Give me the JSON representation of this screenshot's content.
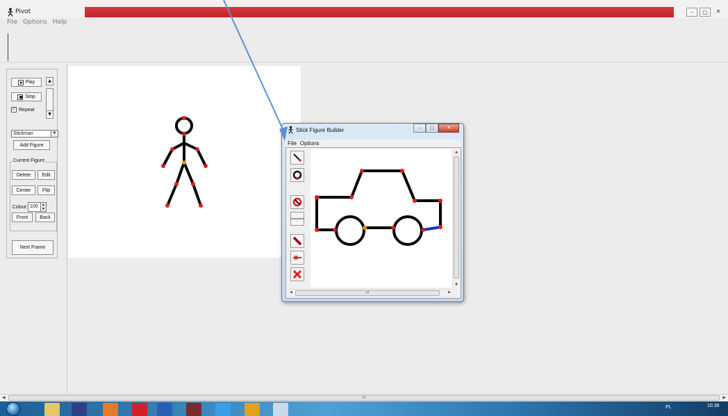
{
  "app": {
    "title": "Pivot",
    "menu": [
      "File",
      "Options",
      "Help"
    ],
    "window_controls": [
      "–",
      "▢",
      "✕"
    ]
  },
  "controls": {
    "play_label": "Play",
    "stop_label": "Stop",
    "repeat_label": "Repeat",
    "repeat_checked": "✓",
    "figure_select": "Stickman",
    "add_figure_label": "Add Figure",
    "current_figure_legend": "Current Figure",
    "delete_label": "Delete",
    "edit_label": "Edit",
    "center_label": "Center",
    "flip_label": "Flip",
    "colour_label": "Colour",
    "colour_value": "100",
    "front_label": "Front",
    "back_label": "Back",
    "next_frame_label": "Next Frame"
  },
  "builder": {
    "title": "Stick Figure Builder",
    "menu": [
      "File",
      "Options"
    ],
    "controls": [
      "–",
      "▢",
      "✕"
    ],
    "scroll_grip": "III"
  },
  "main_scroll_grip": "III",
  "taskbar": {
    "lang": "PL",
    "time": "10:38"
  },
  "colors": {
    "title_accent": "#d0303a",
    "joint_red": "#e01b1b",
    "joint_orange": "#f08a00",
    "segment_blue": "#1030e0",
    "arrow": "#5b8fd4",
    "tool_red": "#e01b1b"
  },
  "icons": {
    "tool_line": "line-tool-icon",
    "tool_circle": "circle-tool-icon",
    "tool_forbid": "no-entry-icon",
    "tool_small": "small-arrows-icon",
    "tool_scale": "scale-segment-icon",
    "tool_static": "static-segment-icon",
    "tool_delete": "delete-x-icon"
  }
}
